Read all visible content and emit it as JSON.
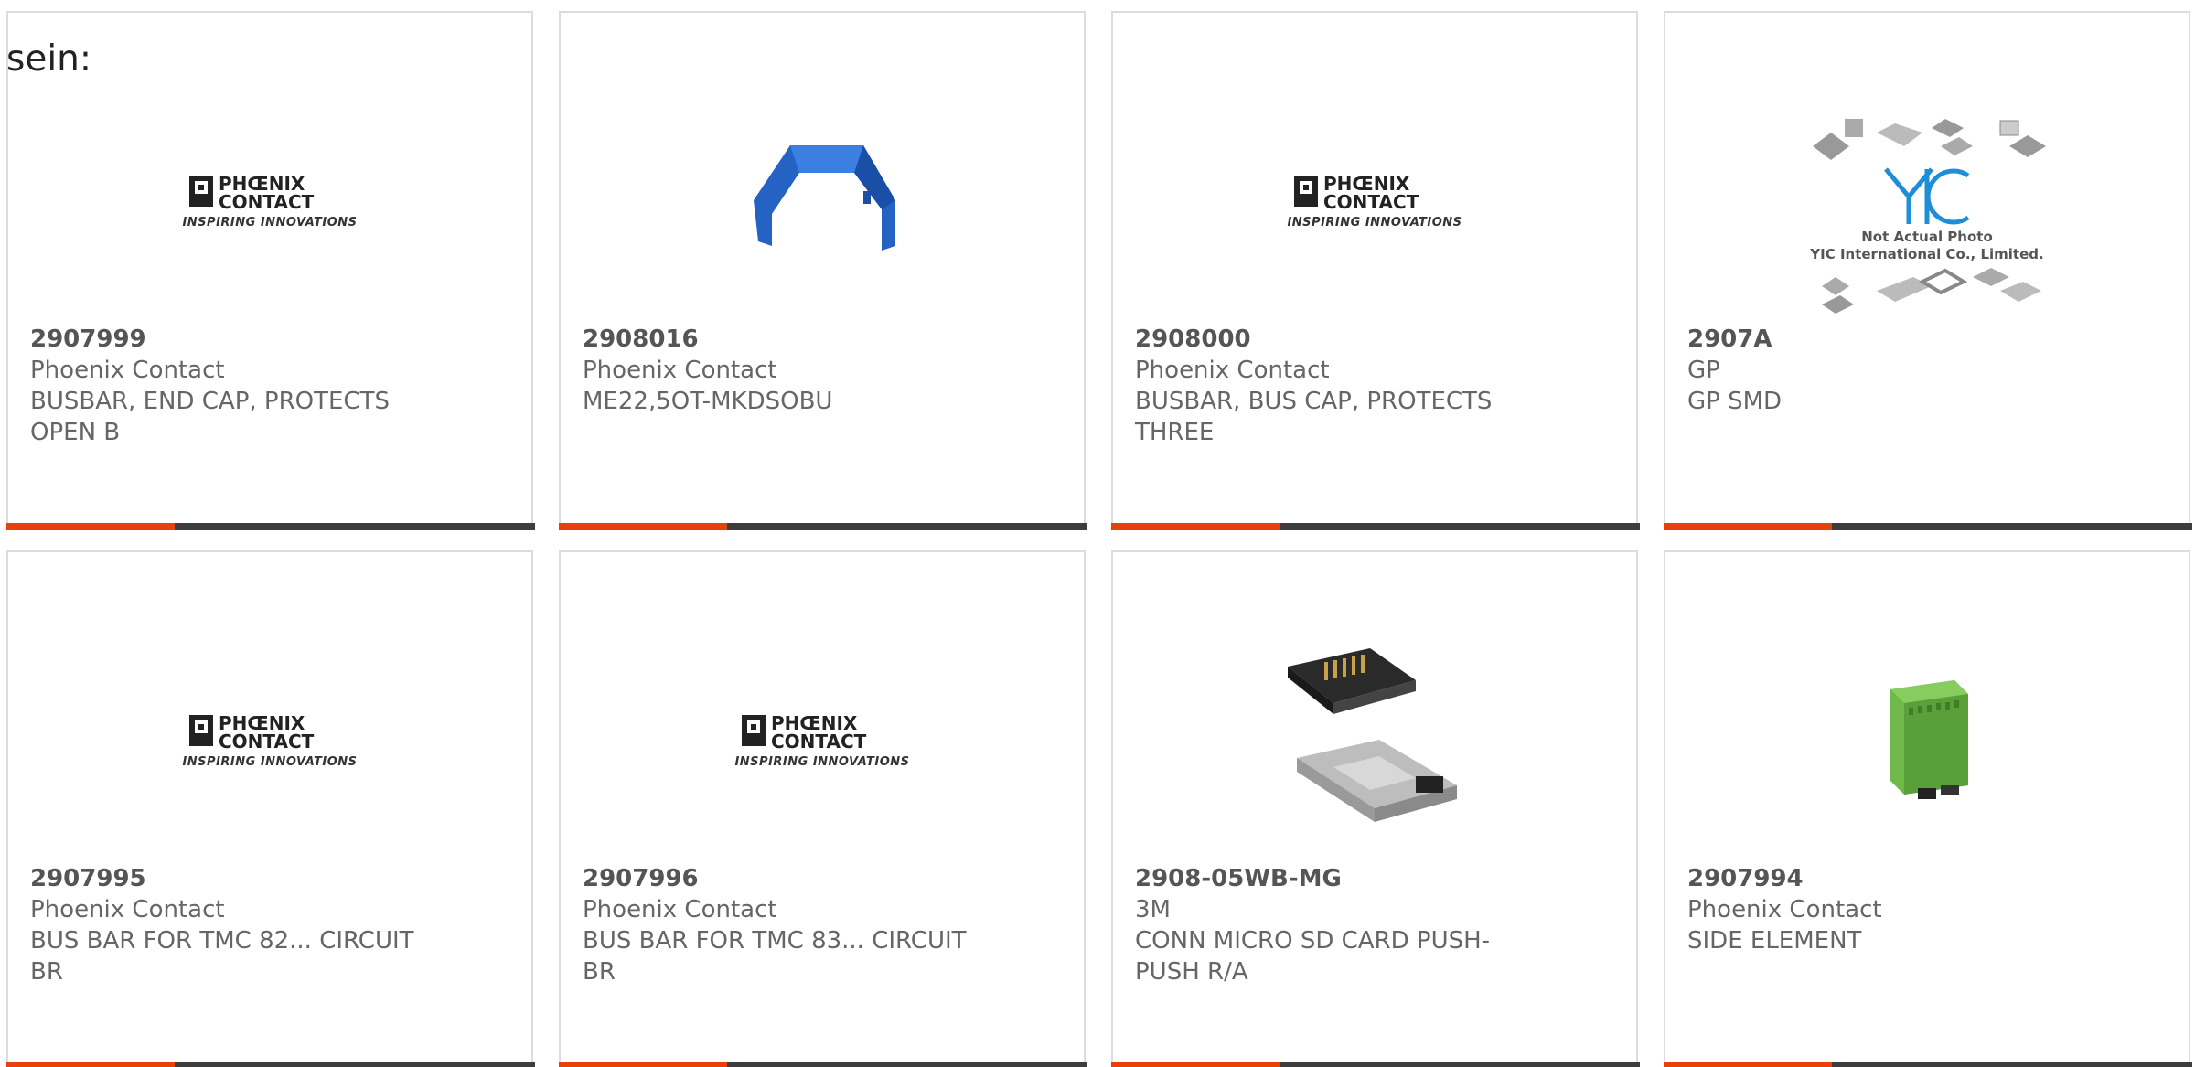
{
  "heading": "sein:",
  "cards": [
    {
      "part": "2907999",
      "manufacturer": "Phoenix Contact",
      "description": "BUSBAR, END CAP, PROTECTS OPEN B",
      "image": "phoenix-contact-logo",
      "logo_tagline": "INSPIRING INNOVATIONS"
    },
    {
      "part": "2908016",
      "manufacturer": "Phoenix Contact",
      "description": "ME22,5OT-MKDSOBU",
      "image": "blue-bracket-photo"
    },
    {
      "part": "2908000",
      "manufacturer": "Phoenix Contact",
      "description": "BUSBAR, BUS CAP, PROTECTS THREE",
      "image": "phoenix-contact-logo",
      "logo_tagline": "INSPIRING INNOVATIONS"
    },
    {
      "part": "2907A",
      "manufacturer": "GP",
      "description": "GP SMD",
      "image": "yic-placeholder",
      "yic_line1": "Not Actual Photo",
      "yic_line2": "YIC International Co., Limited."
    },
    {
      "part": "2907995",
      "manufacturer": "Phoenix Contact",
      "description": "BUS BAR FOR TMC 82... CIRCUIT BR",
      "image": "phoenix-contact-logo",
      "logo_tagline": "INSPIRING INNOVATIONS"
    },
    {
      "part": "2907996",
      "manufacturer": "Phoenix Contact",
      "description": "BUS BAR FOR TMC 83... CIRCUIT BR",
      "image": "phoenix-contact-logo",
      "logo_tagline": "INSPIRING INNOVATIONS"
    },
    {
      "part": "2908-05WB-MG",
      "manufacturer": "3M",
      "description": "CONN MICRO SD CARD PUSH-PUSH R/A",
      "image": "sd-card-connector-photo"
    },
    {
      "part": "2907994",
      "manufacturer": "Phoenix Contact",
      "description": "SIDE ELEMENT",
      "image": "green-module-photo"
    }
  ],
  "colors": {
    "accent": "#e8400c",
    "bar": "#3d3d3d",
    "border": "#dcdcdc",
    "text": "#666666"
  }
}
